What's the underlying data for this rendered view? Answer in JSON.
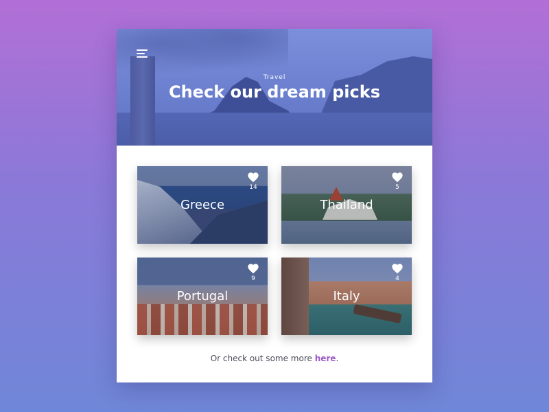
{
  "hero": {
    "tag": "Travel",
    "title": "Check our dream picks",
    "menu_icon": "hamburger-menu-icon"
  },
  "tiles": [
    {
      "name": "Greece",
      "likes": "14",
      "liked_icon": "heart-icon"
    },
    {
      "name": "Thailand",
      "likes": "5",
      "liked_icon": "heart-icon"
    },
    {
      "name": "Portugal",
      "likes": "9",
      "liked_icon": "heart-icon"
    },
    {
      "name": "Italy",
      "likes": "4",
      "liked_icon": "heart-icon"
    }
  ],
  "footer": {
    "prefix": "Or check out some more ",
    "link": "here",
    "suffix": "."
  },
  "colors": {
    "accent": "#9b59c9",
    "background_top": "#b26fd6",
    "background_bottom": "#6f87d8",
    "hero_overlay": "#6073c2"
  }
}
